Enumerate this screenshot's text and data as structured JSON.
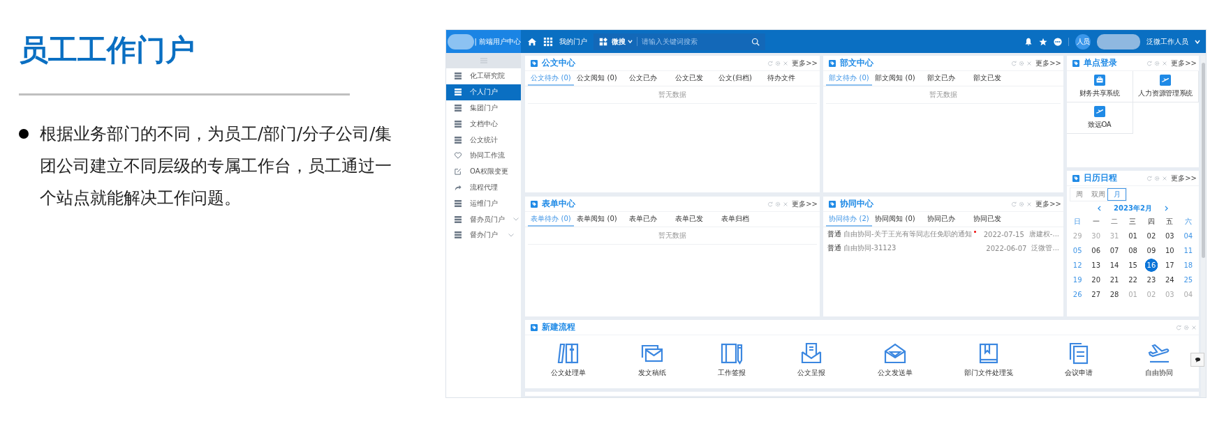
{
  "slide": {
    "title": "员工工作门户",
    "paragraph": "根据业务部门的不同，为员工/部门/分子公司/集团公司建立不同层级的专属工作台，员工通过一个站点就能解决工作问题。"
  },
  "portal": {
    "brand": "| 前端用户中心",
    "nav_label": "我的门户",
    "search_scope": "微搜",
    "search_placeholder": "请输入关键词搜索",
    "user": {
      "avatar": "人员",
      "name": "泛微工作人员"
    },
    "sidebar": [
      {
        "label": "化工研究院",
        "kind": "list",
        "selected": false,
        "expandable": false
      },
      {
        "label": "个人门户",
        "kind": "list",
        "selected": true,
        "expandable": false
      },
      {
        "label": "集团门户",
        "kind": "list",
        "selected": false,
        "expandable": false
      },
      {
        "label": "文档中心",
        "kind": "list",
        "selected": false,
        "expandable": false
      },
      {
        "label": "公文统计",
        "kind": "list",
        "selected": false,
        "expandable": false
      },
      {
        "label": "协同工作流",
        "kind": "heart",
        "selected": false,
        "expandable": false
      },
      {
        "label": "OA权限变更",
        "kind": "edit",
        "selected": false,
        "expandable": false
      },
      {
        "label": "流程代理",
        "kind": "share",
        "selected": false,
        "expandable": false
      },
      {
        "label": "运维门户",
        "kind": "list",
        "selected": false,
        "expandable": false
      },
      {
        "label": "督办员门户",
        "kind": "list",
        "selected": false,
        "expandable": true
      },
      {
        "label": "督办门户",
        "kind": "list",
        "selected": false,
        "expandable": true
      }
    ],
    "panels": [
      {
        "title": "公文中心",
        "more": "更多>>",
        "tabs": [
          {
            "label": "公文待办 (0)",
            "selected": true
          },
          {
            "label": "公文阅知 (0)",
            "selected": false
          },
          {
            "label": "公文已办",
            "selected": false
          },
          {
            "label": "公文已发",
            "selected": false
          },
          {
            "label": "公文(归档)",
            "selected": false
          },
          {
            "label": "待办文件",
            "selected": false
          }
        ],
        "empty": "暂无数据"
      },
      {
        "title": "部文中心",
        "more": "更多>>",
        "tabs": [
          {
            "label": "部文待办 (0)",
            "selected": true
          },
          {
            "label": "部文阅知 (0)",
            "selected": false
          },
          {
            "label": "部文已办",
            "selected": false
          },
          {
            "label": "部文已发",
            "selected": false
          }
        ],
        "empty": "暂无数据"
      },
      {
        "title": "表单中心",
        "more": "更多>>",
        "tabs": [
          {
            "label": "表单待办 (0)",
            "selected": true
          },
          {
            "label": "表单阅知 (0)",
            "selected": false
          },
          {
            "label": "表单已办",
            "selected": false
          },
          {
            "label": "表单已发",
            "selected": false
          },
          {
            "label": "表单归档",
            "selected": false
          }
        ],
        "empty": "暂无数据"
      },
      {
        "title": "协同中心",
        "more": "更多>>",
        "tabs": [
          {
            "label": "协同待办 (2)",
            "selected": true
          },
          {
            "label": "协同阅知 (0)",
            "selected": false
          },
          {
            "label": "协同已办",
            "selected": false
          },
          {
            "label": "协同已发",
            "selected": false
          }
        ],
        "rows": [
          {
            "level": "普通",
            "title": "自由协同-关于王光有等同志任免职的通知",
            "unread": true,
            "date": "2022-07-15",
            "sender": "唐建权-..."
          },
          {
            "level": "普通",
            "title": "自由协同-31123",
            "unread": false,
            "date": "2022-06-07",
            "sender": "泛微管..."
          }
        ]
      }
    ],
    "sso": {
      "title": "单点登录",
      "more": "更多>>",
      "items": [
        {
          "label": "财务共享系统",
          "kind": "bus"
        },
        {
          "label": "人力资源管理系统",
          "kind": "plane"
        },
        {
          "label": "致远OA",
          "kind": "plane"
        }
      ]
    },
    "calendar": {
      "title": "日历日程",
      "more": "更多>>",
      "views": [
        {
          "label": "周",
          "selected": false
        },
        {
          "label": "双周",
          "selected": false
        },
        {
          "label": "月",
          "selected": true
        }
      ],
      "month": "2023年2月",
      "weekdays": [
        "日",
        "一",
        "二",
        "三",
        "四",
        "五",
        "六"
      ],
      "days": [
        {
          "text": "29",
          "muted": true,
          "selected": false
        },
        {
          "text": "30",
          "muted": true,
          "selected": false
        },
        {
          "text": "31",
          "muted": true,
          "selected": false
        },
        {
          "text": "01",
          "muted": false,
          "selected": false
        },
        {
          "text": "02",
          "muted": false,
          "selected": false
        },
        {
          "text": "03",
          "muted": false,
          "selected": false
        },
        {
          "text": "04",
          "muted": false,
          "selected": false
        },
        {
          "text": "05",
          "muted": false,
          "selected": false
        },
        {
          "text": "06",
          "muted": false,
          "selected": false
        },
        {
          "text": "07",
          "muted": false,
          "selected": false
        },
        {
          "text": "08",
          "muted": false,
          "selected": false
        },
        {
          "text": "09",
          "muted": false,
          "selected": false
        },
        {
          "text": "10",
          "muted": false,
          "selected": false
        },
        {
          "text": "11",
          "muted": false,
          "selected": false
        },
        {
          "text": "12",
          "muted": false,
          "selected": false
        },
        {
          "text": "13",
          "muted": false,
          "selected": false
        },
        {
          "text": "14",
          "muted": false,
          "selected": false
        },
        {
          "text": "15",
          "muted": false,
          "selected": false
        },
        {
          "text": "16",
          "muted": false,
          "selected": true
        },
        {
          "text": "17",
          "muted": false,
          "selected": false
        },
        {
          "text": "18",
          "muted": false,
          "selected": false
        },
        {
          "text": "19",
          "muted": false,
          "selected": false
        },
        {
          "text": "20",
          "muted": false,
          "selected": false
        },
        {
          "text": "21",
          "muted": false,
          "selected": false
        },
        {
          "text": "22",
          "muted": false,
          "selected": false
        },
        {
          "text": "23",
          "muted": false,
          "selected": false
        },
        {
          "text": "24",
          "muted": false,
          "selected": false
        },
        {
          "text": "25",
          "muted": false,
          "selected": false
        },
        {
          "text": "26",
          "muted": false,
          "selected": false
        },
        {
          "text": "27",
          "muted": false,
          "selected": false
        },
        {
          "text": "28",
          "muted": false,
          "selected": false
        },
        {
          "text": "01",
          "muted": true,
          "selected": false
        },
        {
          "text": "02",
          "muted": true,
          "selected": false
        },
        {
          "text": "03",
          "muted": true,
          "selected": false
        },
        {
          "text": "04",
          "muted": true,
          "selected": false
        }
      ]
    },
    "new_flow": {
      "title": "新建流程",
      "items": [
        {
          "label": "公文处理单",
          "kind": "binders"
        },
        {
          "label": "发文稿纸",
          "kind": "envelopes"
        },
        {
          "label": "工作签报",
          "kind": "book-pen"
        },
        {
          "label": "公文呈报",
          "kind": "envelope-doc"
        },
        {
          "label": "公文发送单",
          "kind": "open-envelope"
        },
        {
          "label": "部门文件处理笺",
          "kind": "bookmark-book"
        },
        {
          "label": "会议申请",
          "kind": "documents"
        },
        {
          "label": "自由协同",
          "kind": "plane"
        }
      ]
    }
  }
}
